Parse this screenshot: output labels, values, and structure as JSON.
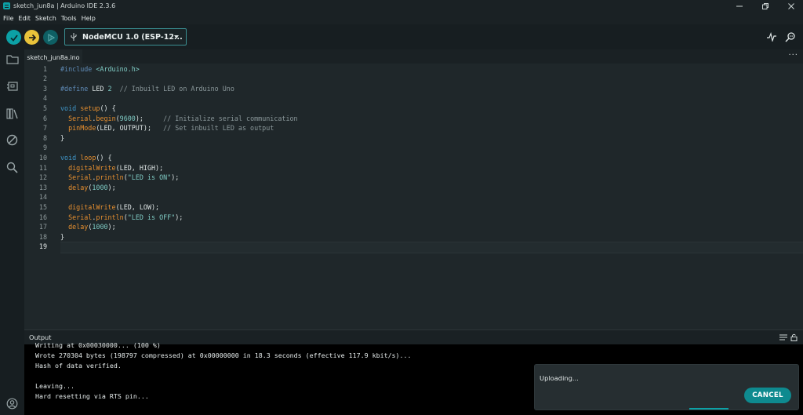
{
  "window": {
    "title": "sketch_jun8a | Arduino IDE 2.3.6"
  },
  "menu": [
    "File",
    "Edit",
    "Sketch",
    "Tools",
    "Help"
  ],
  "toolbar": {
    "board": "NodeMCU 1.0 (ESP-12..."
  },
  "tabs": [
    {
      "label": "sketch_jun8a.ino"
    }
  ],
  "tab_more": "···",
  "editor": {
    "current_line": 19,
    "lines": [
      [
        [
          "k-pre",
          "#include "
        ],
        [
          "k-str",
          "<Arduino.h>"
        ]
      ],
      [],
      [
        [
          "k-pre",
          "#define "
        ],
        [
          "k-plain",
          "LED "
        ],
        [
          "k-num",
          "2"
        ],
        [
          "k-plain",
          "  "
        ],
        [
          "k-cm",
          "// Inbuilt LED on Arduino Uno"
        ]
      ],
      [],
      [
        [
          "k-type",
          "void "
        ],
        [
          "k-fn",
          "setup"
        ],
        [
          "k-plain",
          "() {"
        ]
      ],
      [
        [
          "k-plain",
          "  "
        ],
        [
          "k-fn",
          "Serial"
        ],
        [
          "k-plain",
          "."
        ],
        [
          "k-fn",
          "begin"
        ],
        [
          "k-plain",
          "("
        ],
        [
          "k-num",
          "9600"
        ],
        [
          "k-plain",
          ");     "
        ],
        [
          "k-cm",
          "// Initialize serial communication"
        ]
      ],
      [
        [
          "k-plain",
          "  "
        ],
        [
          "k-fn",
          "pinMode"
        ],
        [
          "k-plain",
          "(LED, OUTPUT);   "
        ],
        [
          "k-cm",
          "// Set inbuilt LED as output"
        ]
      ],
      [
        [
          "k-plain",
          "}"
        ]
      ],
      [],
      [
        [
          "k-type",
          "void "
        ],
        [
          "k-fn",
          "loop"
        ],
        [
          "k-plain",
          "() {"
        ]
      ],
      [
        [
          "k-plain",
          "  "
        ],
        [
          "k-fn",
          "digitalWrite"
        ],
        [
          "k-plain",
          "(LED, HIGH);"
        ]
      ],
      [
        [
          "k-plain",
          "  "
        ],
        [
          "k-fn",
          "Serial"
        ],
        [
          "k-plain",
          "."
        ],
        [
          "k-fn",
          "println"
        ],
        [
          "k-plain",
          "("
        ],
        [
          "k-str",
          "\"LED is ON\""
        ],
        [
          "k-plain",
          ");"
        ]
      ],
      [
        [
          "k-plain",
          "  "
        ],
        [
          "k-fn",
          "delay"
        ],
        [
          "k-plain",
          "("
        ],
        [
          "k-num",
          "1000"
        ],
        [
          "k-plain",
          ");"
        ]
      ],
      [],
      [
        [
          "k-plain",
          "  "
        ],
        [
          "k-fn",
          "digitalWrite"
        ],
        [
          "k-plain",
          "(LED, LOW);"
        ]
      ],
      [
        [
          "k-plain",
          "  "
        ],
        [
          "k-fn",
          "Serial"
        ],
        [
          "k-plain",
          "."
        ],
        [
          "k-fn",
          "println"
        ],
        [
          "k-plain",
          "("
        ],
        [
          "k-str",
          "\"LED is OFF\""
        ],
        [
          "k-plain",
          ");"
        ]
      ],
      [
        [
          "k-plain",
          "  "
        ],
        [
          "k-fn",
          "delay"
        ],
        [
          "k-plain",
          "("
        ],
        [
          "k-num",
          "1000"
        ],
        [
          "k-plain",
          ");"
        ]
      ],
      [
        [
          "k-plain",
          "}"
        ]
      ],
      []
    ]
  },
  "output": {
    "label": "Output",
    "lines": [
      "Writing at 0x00030000... (100 %)",
      "Wrote 270304 bytes (198797 compressed) at 0x00000000 in 18.3 seconds (effective 117.9 kbit/s)...",
      "Hash of data verified.",
      "",
      "Leaving...",
      "Hard resetting via RTS pin..."
    ]
  },
  "toast": {
    "message": "Uploading...",
    "cancel_label": "CANCEL"
  }
}
